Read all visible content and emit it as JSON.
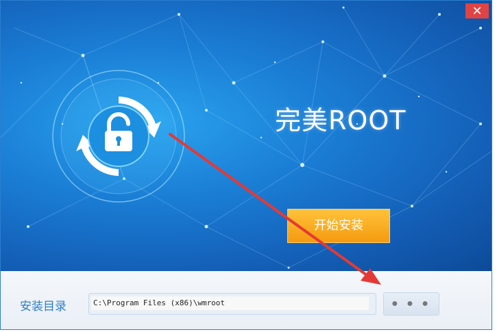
{
  "window": {
    "close_label": "✕"
  },
  "hero": {
    "app_title": "完美ROOT",
    "install_button_label": "开始安装"
  },
  "footer": {
    "install_dir_label": "安装目录",
    "install_path_value": "C:\\Program Files (x86)\\wmroot",
    "browse_button_label": "● ● ●"
  },
  "icons": [
    "close-icon",
    "unlock-icon",
    "refresh-arrows-icon",
    "annotation-arrow"
  ],
  "colors": {
    "hero_blue": "#1b7fd6",
    "install_orange": "#f59a0f",
    "label_blue": "#2c7fc9",
    "close_red": "#e04343",
    "annotation_red": "#e53935"
  }
}
